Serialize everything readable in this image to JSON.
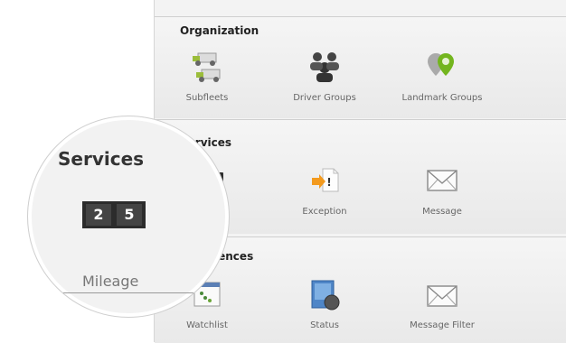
{
  "organization": {
    "title": "Organization",
    "items": [
      {
        "label": "Subfleets",
        "icon": "subfleets-icon"
      },
      {
        "label": "Driver Groups",
        "icon": "driver-groups-icon"
      },
      {
        "label": "Landmark Groups",
        "icon": "landmark-groups-icon"
      }
    ]
  },
  "services": {
    "title": "Services",
    "items": [
      {
        "label": "Mileage",
        "icon": "mileage-icon",
        "display": "2 5"
      },
      {
        "label": "Exception",
        "icon": "exception-icon"
      },
      {
        "label": "Message",
        "icon": "message-icon"
      }
    ]
  },
  "preferences": {
    "title": "Preferences",
    "items": [
      {
        "label": "Watchlist",
        "icon": "watchlist-icon"
      },
      {
        "label": "Status",
        "icon": "status-icon"
      },
      {
        "label": "Message Filter",
        "icon": "message-filter-icon"
      }
    ]
  },
  "zoom": {
    "title": "Services",
    "label": "Mileage",
    "digits": [
      "2",
      "5"
    ]
  },
  "colors": {
    "accent_orange": "#f39a1e",
    "landmark_green": "#73b51e",
    "panel_bg": "#f3f3f3"
  }
}
